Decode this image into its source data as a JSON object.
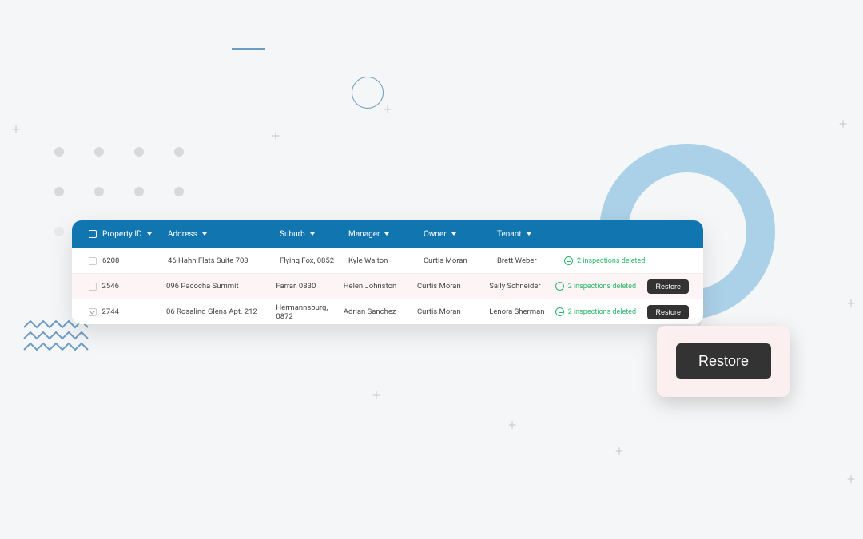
{
  "table": {
    "headers": {
      "property_id": "Property ID",
      "address": "Address",
      "suburb": "Suburb",
      "manager": "Manager",
      "owner": "Owner",
      "tenant": "Tenant"
    },
    "rows": [
      {
        "selected": false,
        "property_id": "6208",
        "address": "46 Hahn Flats Suite 703",
        "suburb": "Flying Fox, 0852",
        "manager": "Kyle Walton",
        "owner": "Curtis Moran",
        "tenant": "Brett Weber",
        "status": "2 inspections deleted",
        "has_restore": false
      },
      {
        "selected": false,
        "property_id": "2546",
        "address": "096 Pacocha Summit",
        "suburb": "Farrar, 0830",
        "manager": "Helen Johnston",
        "owner": "Curtis Moran",
        "tenant": "Sally Schneider",
        "status": "2 inspections deleted",
        "has_restore": true
      },
      {
        "selected": true,
        "property_id": "2744",
        "address": "06 Rosalind Glens Apt. 212",
        "suburb": "Hermannsburg, 0872",
        "manager": "Adrian Sanchez",
        "owner": "Curtis Moran",
        "tenant": "Lenora Sherman",
        "status": "2 inspections deleted",
        "has_restore": true
      }
    ],
    "restore_label": "Restore"
  },
  "popout": {
    "button_label": "Restore"
  }
}
